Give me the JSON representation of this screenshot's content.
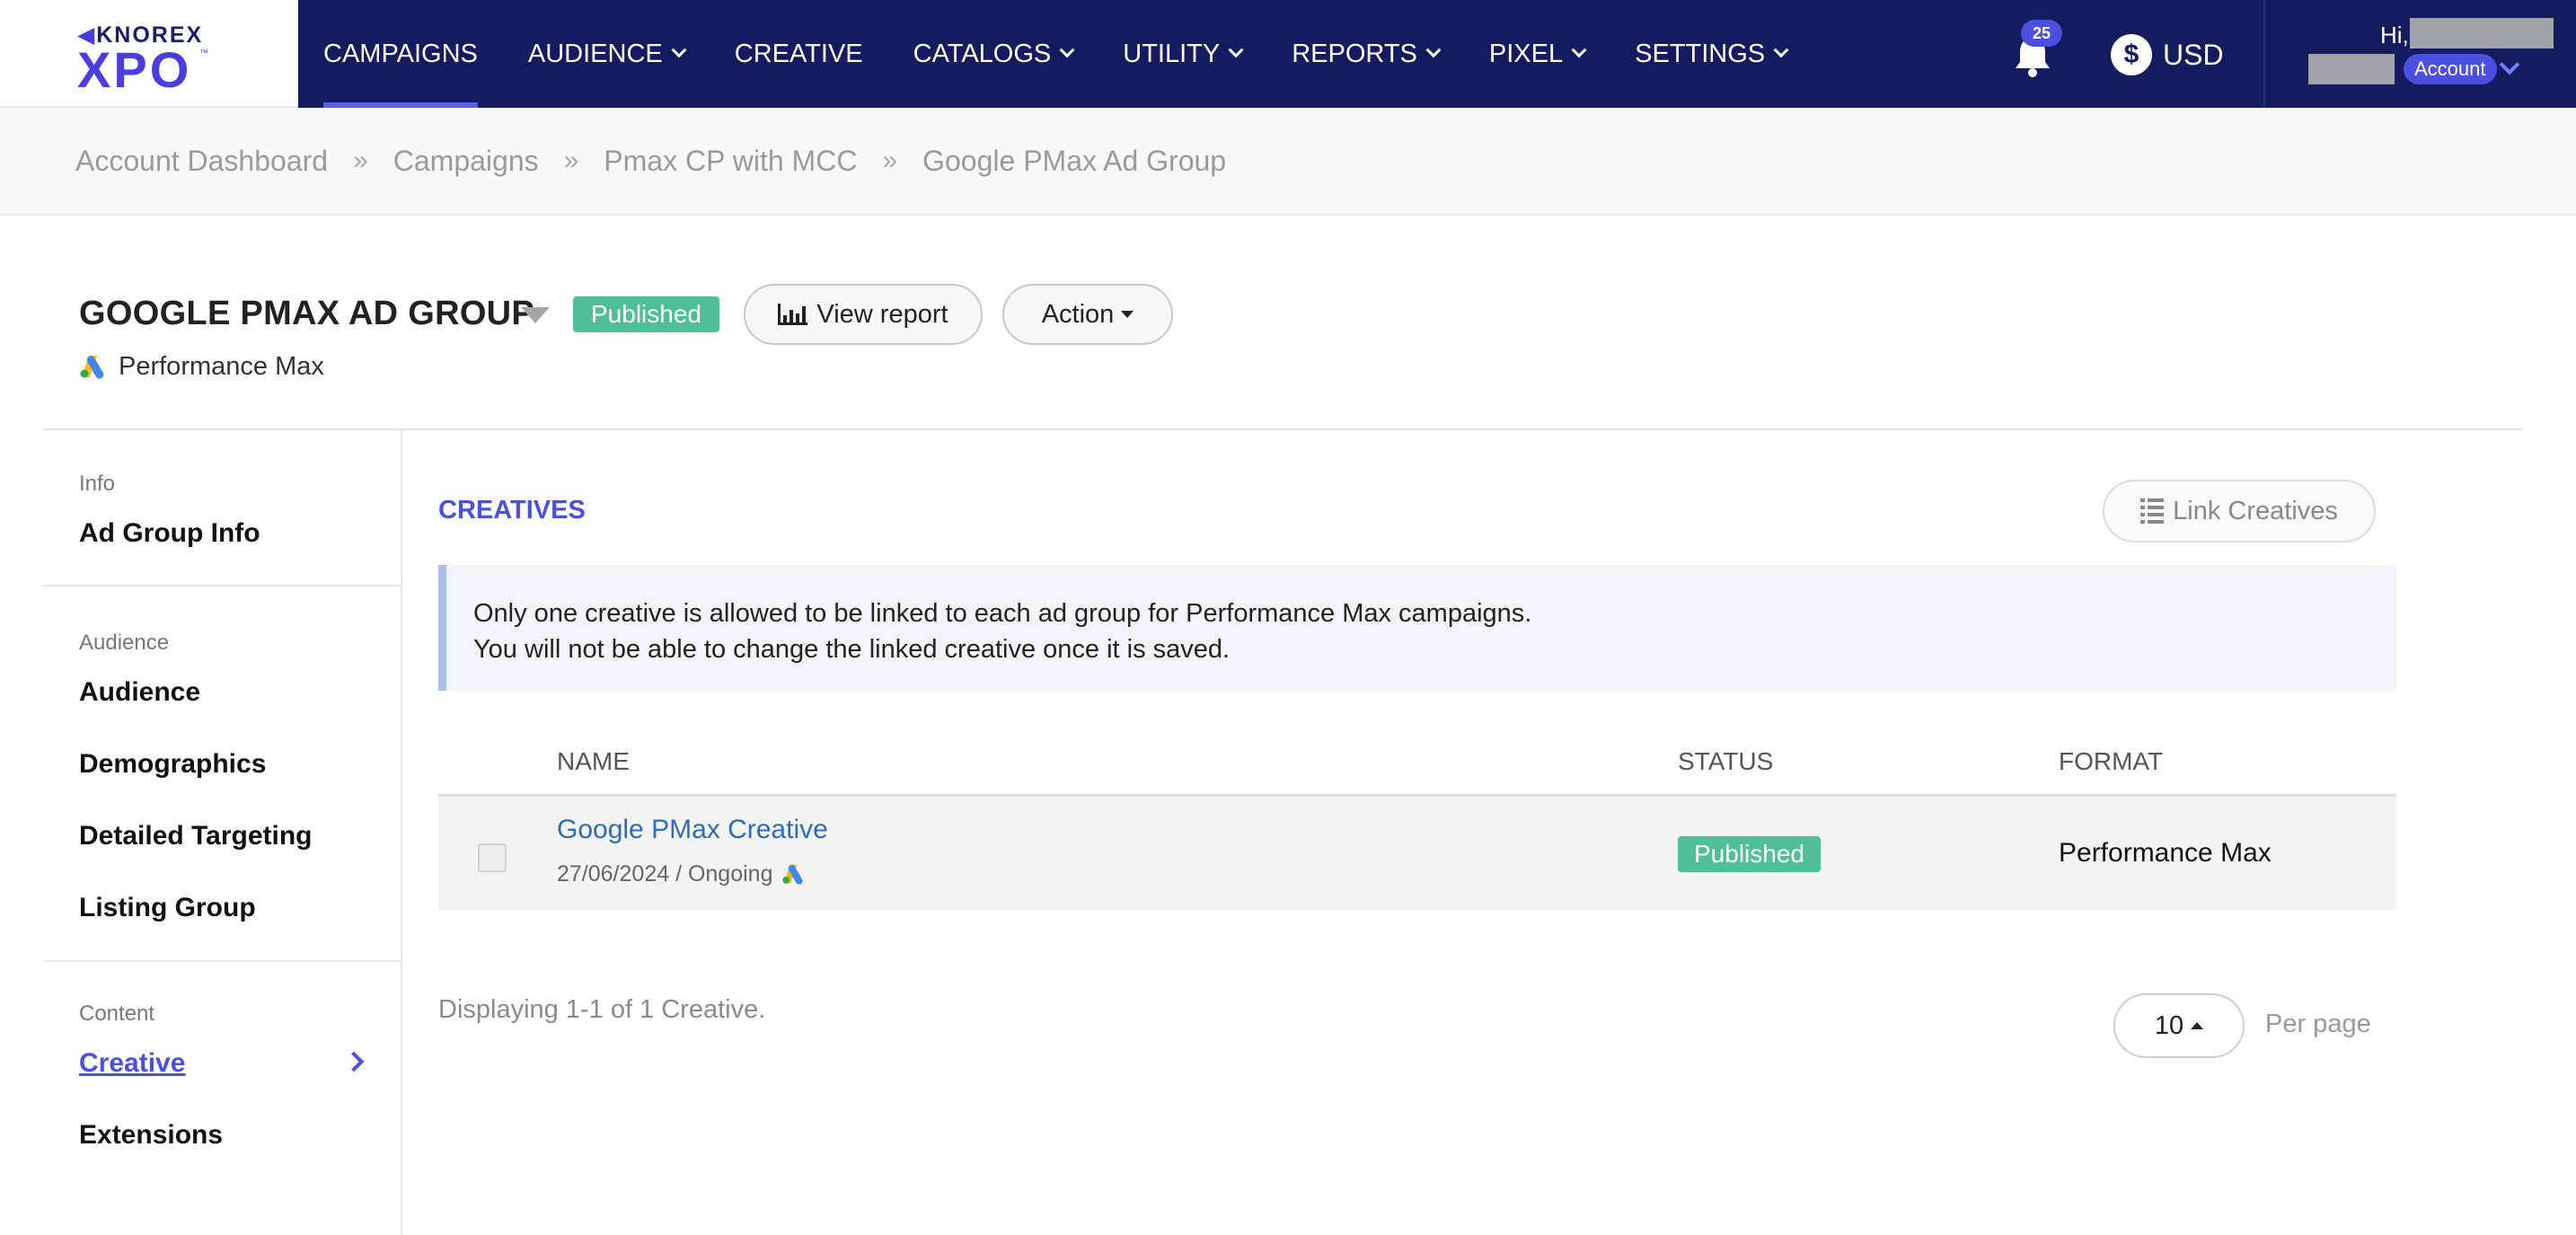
{
  "brand": {
    "top": "KNOREX",
    "main": "XPO",
    "tm": "™"
  },
  "nav": {
    "items": [
      {
        "label": "CAMPAIGNS",
        "dropdown": false,
        "active": true
      },
      {
        "label": "AUDIENCE",
        "dropdown": true,
        "active": false
      },
      {
        "label": "CREATIVE",
        "dropdown": false,
        "active": false
      },
      {
        "label": "CATALOGS",
        "dropdown": true,
        "active": false
      },
      {
        "label": "UTILITY",
        "dropdown": true,
        "active": false
      },
      {
        "label": "REPORTS",
        "dropdown": true,
        "active": false
      },
      {
        "label": "PIXEL",
        "dropdown": true,
        "active": false
      },
      {
        "label": "SETTINGS",
        "dropdown": true,
        "active": false
      }
    ],
    "notifications_count": "25",
    "currency": "USD",
    "greeting": "Hi,",
    "account_badge": "Account"
  },
  "breadcrumb": [
    "Account Dashboard",
    "Campaigns",
    "Pmax CP with MCC",
    "Google PMax Ad Group"
  ],
  "header": {
    "title": "GOOGLE PMAX AD GROUP",
    "status": "Published",
    "view_report": "View report",
    "action": "Action",
    "subtitle": "Performance Max"
  },
  "sidebar": {
    "sections": [
      {
        "heading": "Info",
        "items": [
          "Ad Group Info"
        ]
      },
      {
        "heading": "Audience",
        "items": [
          "Audience",
          "Demographics",
          "Detailed Targeting",
          "Listing Group"
        ]
      },
      {
        "heading": "Content",
        "items": [
          "Creative",
          "Extensions"
        ]
      }
    ],
    "active_item": "Creative"
  },
  "main": {
    "section_title": "CREATIVES",
    "link_button": "Link Creatives",
    "notice_line1": "Only one creative is allowed to be linked to each ad group for Performance Max campaigns.",
    "notice_line2": "You will not be able to change the linked creative once it is saved.",
    "columns": {
      "name": "NAME",
      "status": "STATUS",
      "format": "FORMAT"
    },
    "rows": [
      {
        "name": "Google PMax Creative",
        "meta": "27/06/2024 / Ongoing",
        "status": "Published",
        "format": "Performance Max"
      }
    ],
    "displaying": "Displaying 1-1 of 1 Creative.",
    "per_page_value": "10",
    "per_page_label": "Per page"
  },
  "colors": {
    "nav_bg": "#141b5e",
    "accent": "#4b50e0",
    "published_green": "#4fbf98",
    "link_blue": "#2e6bb8"
  }
}
